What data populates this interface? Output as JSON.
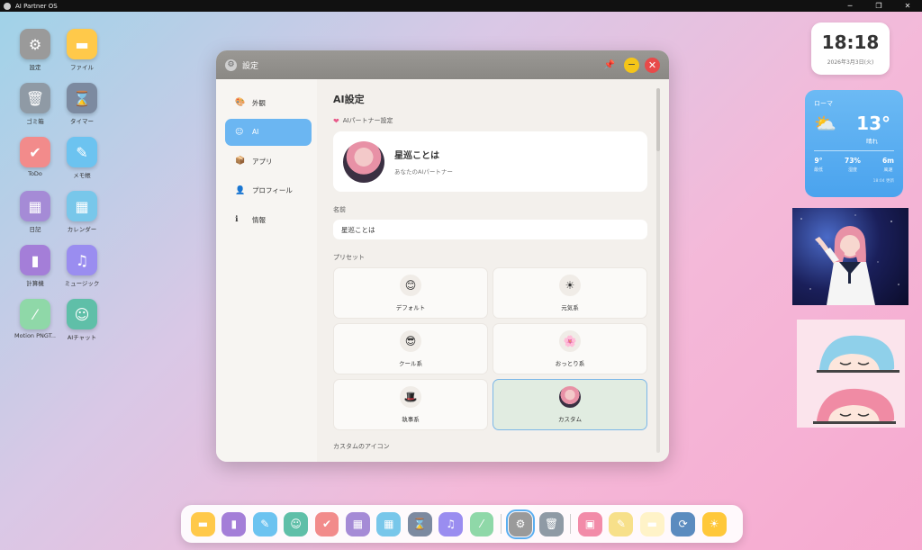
{
  "titlebar": {
    "title": "AI Partner OS",
    "minimize": "─",
    "maximize": "❐",
    "close": "✕"
  },
  "desktop_icons": [
    {
      "label": "設定",
      "icon": "gear-icon",
      "glyph": "⚙",
      "color": "#9a9a9a",
      "col": 0,
      "row": 0
    },
    {
      "label": "ファイル",
      "icon": "folder-icon",
      "glyph": "▬",
      "color": "#ffc94a",
      "col": 1,
      "row": 0
    },
    {
      "label": "ゴミ箱",
      "icon": "trash-icon",
      "glyph": "🗑",
      "color": "#8f9aa5",
      "col": 0,
      "row": 1
    },
    {
      "label": "タイマー",
      "icon": "hourglass-icon",
      "glyph": "⌛",
      "color": "#7c8aa0",
      "col": 1,
      "row": 1
    },
    {
      "label": "ToDo",
      "icon": "checkbox-icon",
      "glyph": "✔",
      "color": "#f28b8b",
      "col": 0,
      "row": 2
    },
    {
      "label": "メモ帳",
      "icon": "notepad-icon",
      "glyph": "✎",
      "color": "#6cc3f0",
      "col": 1,
      "row": 2
    },
    {
      "label": "日記",
      "icon": "diary-icon",
      "glyph": "▦",
      "color": "#a58bd6",
      "col": 0,
      "row": 3
    },
    {
      "label": "カレンダー",
      "icon": "calendar-icon",
      "glyph": "▦",
      "color": "#78c7ea",
      "col": 1,
      "row": 3
    },
    {
      "label": "計算機",
      "icon": "calculator-icon",
      "glyph": "▮",
      "color": "#a47ed8",
      "col": 0,
      "row": 4
    },
    {
      "label": "ミュージック",
      "icon": "music-icon",
      "glyph": "♫",
      "color": "#9a8df0",
      "col": 1,
      "row": 4
    },
    {
      "label": "Motion PNGT...",
      "icon": "wand-icon",
      "glyph": "⁄",
      "color": "#8fd8a8",
      "col": 0,
      "row": 5
    },
    {
      "label": "AIチャット",
      "icon": "robot-icon",
      "glyph": "☺",
      "color": "#5fbfa8",
      "col": 1,
      "row": 5
    }
  ],
  "window": {
    "title": "設定",
    "pin": "📌",
    "minimize": "−",
    "close": "✕",
    "nav": [
      {
        "label": "外観",
        "icon": "palette-icon",
        "glyph": "🎨",
        "active": false
      },
      {
        "label": "AI",
        "icon": "robot-icon",
        "glyph": "☺",
        "active": true
      },
      {
        "label": "アプリ",
        "icon": "box-icon",
        "glyph": "📦",
        "active": false
      },
      {
        "label": "プロフィール",
        "icon": "user-icon",
        "glyph": "👤",
        "active": false
      },
      {
        "label": "情報",
        "icon": "info-icon",
        "glyph": "ℹ",
        "active": false
      }
    ],
    "content": {
      "heading": "AI設定",
      "partner_section": "AIパートナー設定",
      "partner_name": "星巡ことは",
      "partner_desc": "あなたのAIパートナー",
      "name_label": "名前",
      "name_value": "星巡ことは",
      "preset_label": "プリセット",
      "presets": [
        {
          "label": "デフォルト",
          "icon": "smile-icon",
          "glyph": "😊",
          "selected": false
        },
        {
          "label": "元気系",
          "icon": "sun-icon",
          "glyph": "☀",
          "selected": false
        },
        {
          "label": "クール系",
          "icon": "sunglasses-icon",
          "glyph": "😎",
          "selected": false
        },
        {
          "label": "おっとり系",
          "icon": "flower-icon",
          "glyph": "🌸",
          "selected": false
        },
        {
          "label": "執事系",
          "icon": "tophat-icon",
          "glyph": "🎩",
          "selected": false
        },
        {
          "label": "カスタム",
          "icon": "custom-avatar-icon",
          "glyph": "",
          "selected": true
        }
      ],
      "custom_icon_label": "カスタムのアイコン"
    }
  },
  "clock": {
    "time": "18:18",
    "date": "2026年3月3日(火)"
  },
  "weather": {
    "city": "ローマ",
    "temp": "13°",
    "condition": "晴れ",
    "stats": [
      {
        "value": "9°",
        "label": "最低"
      },
      {
        "value": "73%",
        "label": "湿度"
      },
      {
        "value": "6m",
        "label": "風速"
      }
    ],
    "updated": "18:04 更新"
  },
  "dock": [
    {
      "icon": "folder-icon",
      "glyph": "▬",
      "color": "#ffc94a"
    },
    {
      "icon": "calculator-icon",
      "glyph": "▮",
      "color": "#a47ed8"
    },
    {
      "icon": "notepad-icon",
      "glyph": "✎",
      "color": "#6cc3f0"
    },
    {
      "icon": "robot-icon",
      "glyph": "☺",
      "color": "#5fbfa8"
    },
    {
      "icon": "checkbox-icon",
      "glyph": "✔",
      "color": "#f28b8b"
    },
    {
      "icon": "diary-icon",
      "glyph": "▦",
      "color": "#a58bd6"
    },
    {
      "icon": "calendar-icon",
      "glyph": "▦",
      "color": "#78c7ea"
    },
    {
      "icon": "hourglass-icon",
      "glyph": "⌛",
      "color": "#7c8aa0"
    },
    {
      "icon": "music-icon",
      "glyph": "♫",
      "color": "#9a8df0"
    },
    {
      "icon": "wand-icon",
      "glyph": "⁄",
      "color": "#8fd8a8"
    },
    {
      "sep": true
    },
    {
      "icon": "gear-icon",
      "glyph": "⚙",
      "color": "#9a9a9a",
      "active": true
    },
    {
      "icon": "trash-icon",
      "glyph": "🗑",
      "color": "#8f9aa5"
    },
    {
      "sep": true
    },
    {
      "icon": "image-icon",
      "glyph": "▣",
      "color": "#f28ba8"
    },
    {
      "icon": "notepad-icon",
      "glyph": "✎",
      "color": "#f7e08a"
    },
    {
      "icon": "file-folder-icon",
      "glyph": "▬",
      "color": "#fff3c8"
    },
    {
      "icon": "sync-icon",
      "glyph": "⟳",
      "color": "#5b8bbf"
    },
    {
      "icon": "sun-icon",
      "glyph": "☀",
      "color": "#ffc83a"
    }
  ]
}
